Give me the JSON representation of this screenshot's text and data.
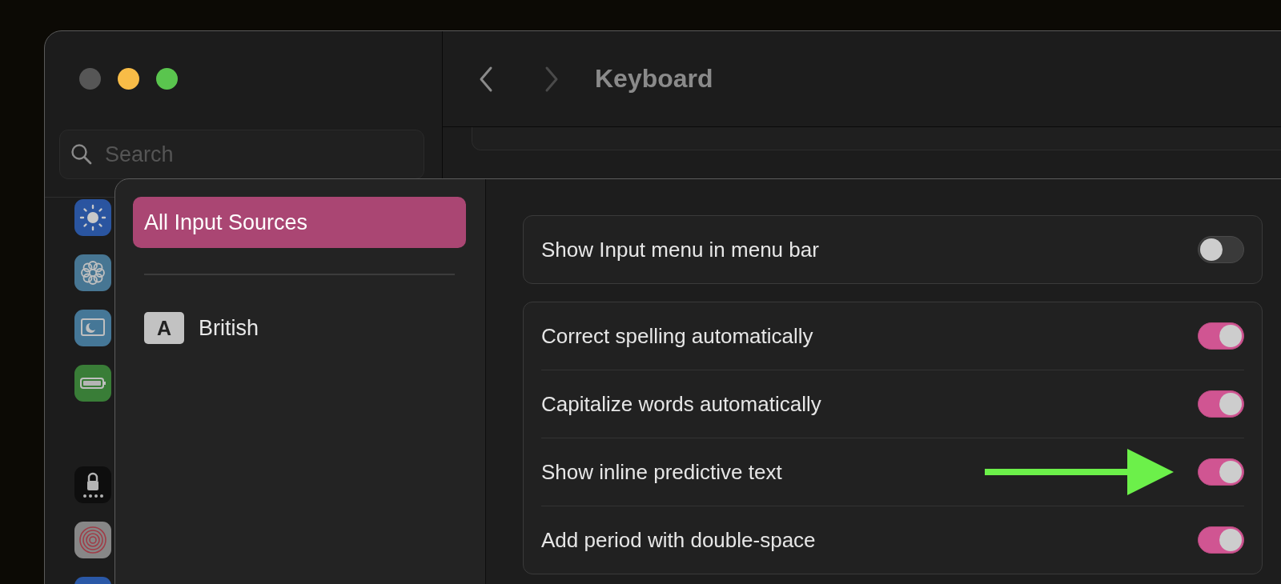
{
  "window": {
    "title": "Keyboard"
  },
  "sidebar": {
    "search": {
      "placeholder": "Search"
    },
    "icons": [
      {
        "kind": "display"
      },
      {
        "kind": "wallpaper"
      },
      {
        "kind": "screensaver"
      },
      {
        "kind": "battery"
      },
      {
        "kind": "lock"
      },
      {
        "kind": "touchid"
      },
      {
        "kind": "users"
      }
    ]
  },
  "sheet": {
    "sources": [
      {
        "label": "All Input Sources",
        "selected": true
      },
      {
        "label": "British",
        "selected": false,
        "badge": "A"
      }
    ],
    "groups": [
      {
        "rows": [
          {
            "label": "Show Input menu in menu bar",
            "on": false,
            "annotated": false
          }
        ]
      },
      {
        "rows": [
          {
            "label": "Correct spelling automatically",
            "on": true,
            "annotated": false
          },
          {
            "label": "Capitalize words automatically",
            "on": true,
            "annotated": false
          },
          {
            "label": "Show inline predictive text",
            "on": true,
            "annotated": true
          },
          {
            "label": "Add period with double-space",
            "on": true,
            "annotated": false
          }
        ]
      }
    ]
  }
}
